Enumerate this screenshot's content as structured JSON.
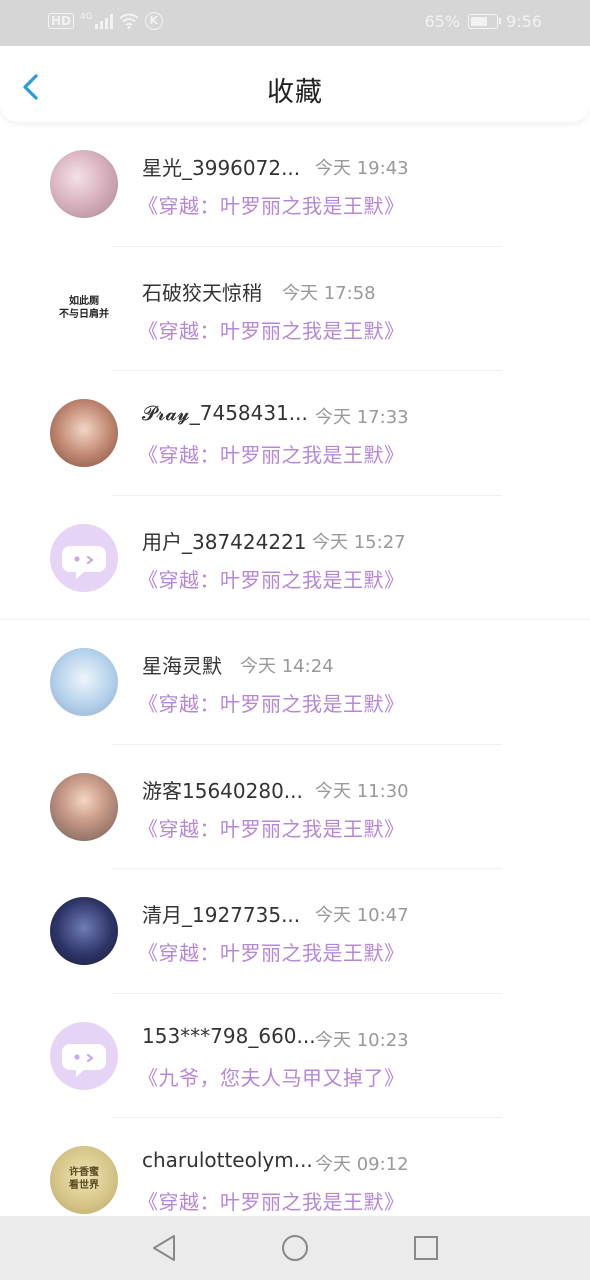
{
  "status_bar": {
    "hd": "HD",
    "network": "4G",
    "carrier_badge": "K",
    "battery": "65%",
    "battery_level": 0.65,
    "time": "9:56",
    "icons": [
      "signal-icon",
      "wifi-icon",
      "battery-icon"
    ]
  },
  "header": {
    "title": "收藏",
    "back_icon": "chevron-left-icon",
    "accent_color": "#2b9be0"
  },
  "items": [
    {
      "name": "星光_3996072...",
      "time": "今天 19:43",
      "book": "《穿越：叶罗丽之我是王默》",
      "avatar": "av-pink"
    },
    {
      "name": "石破狡天惊稍",
      "time": "今天 17:58",
      "book": "《穿越：叶罗丽之我是王默》",
      "avatar": "av-bw",
      "avatar_text_1": "如此厕",
      "avatar_text_2": "不与日肩并"
    },
    {
      "name": "𝓟𝓻𝓪𝔂_7458431...",
      "time": "今天 17:33",
      "book": "《穿越：叶罗丽之我是王默》",
      "avatar": "av-girl"
    },
    {
      "name": "用户_387424221",
      "time": "今天 15:27",
      "book": "《穿越：叶罗丽之我是王默》",
      "avatar": "av-default"
    },
    {
      "name": "星海灵默",
      "time": "今天 14:24",
      "book": "《穿越：叶罗丽之我是王默》",
      "avatar": "av-anime"
    },
    {
      "name": "游客15640280...",
      "time": "今天 11:30",
      "book": "《穿越：叶罗丽之我是王默》",
      "avatar": "av-photo"
    },
    {
      "name": "清月_1927735...",
      "time": "今天 10:47",
      "book": "《穿越：叶罗丽之我是王默》",
      "avatar": "av-dark"
    },
    {
      "name": "153***798_660...",
      "time": "今天 10:23",
      "book": "《九爷，您夫人马甲又掉了》",
      "avatar": "av-default"
    },
    {
      "name": "charulotteolym...",
      "time": "今天 09:12",
      "book": "《穿越：叶罗丽之我是王默》",
      "avatar": "av-gold",
      "avatar_text_1": "许香蜜",
      "avatar_text_2": "看世界"
    }
  ],
  "nav": {
    "back": "triangle-back-icon",
    "home": "circle-home-icon",
    "recents": "square-recents-icon"
  },
  "colors": {
    "book_title": "#b687d8",
    "time_text": "#999999",
    "name_text": "#333333",
    "default_avatar_bg": "#e6d4f6"
  }
}
